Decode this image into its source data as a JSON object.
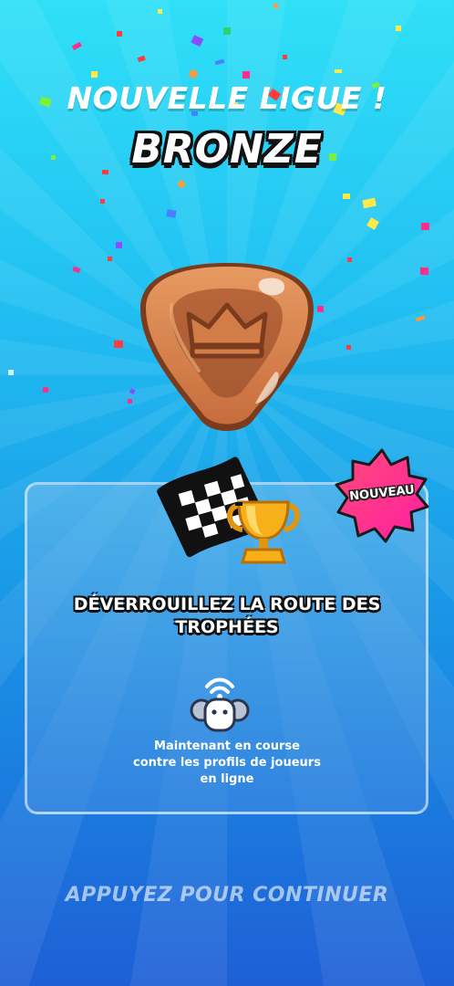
{
  "header": {
    "title": "NOUVELLE LIGUE !",
    "league_name": "BRONZE"
  },
  "league_badge": {
    "tier": "bronze",
    "icon": "crown-icon",
    "color": "#d98a55"
  },
  "unlock_panel": {
    "new_badge_label": "NOUVEAU",
    "title_lines": [
      "DÉVERROUILLEZ LA ROUTE DES",
      "TROPHÉES"
    ],
    "icons": [
      "checkered-flag-icon",
      "trophy-icon",
      "online-players-icon"
    ],
    "description_lines": [
      "Maintenant en course",
      "contre les profils de joueurs",
      "en ligne"
    ]
  },
  "footer": {
    "continue_label": "APPUYEZ POUR CONTINUER"
  },
  "colors": {
    "background_top": "#2fe0f7",
    "background_bottom": "#1f5fd6",
    "new_badge": "#ff2d8a",
    "trophy": "#f5b01a"
  }
}
